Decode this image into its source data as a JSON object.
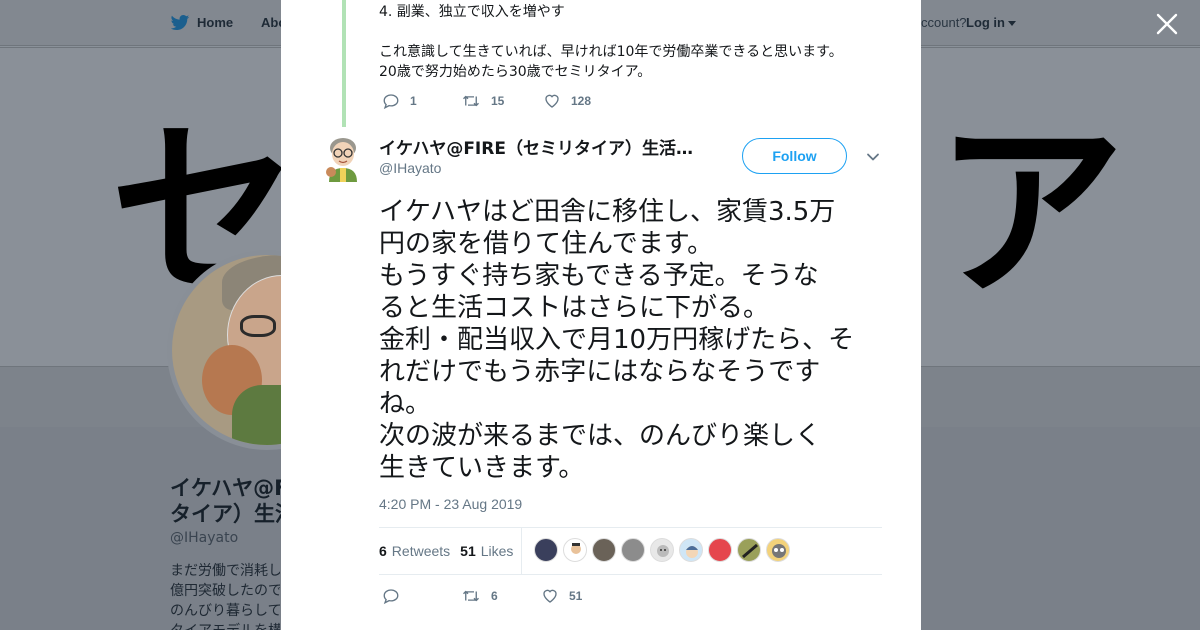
{
  "background": {
    "nav": {
      "home_label": "Home",
      "about_label": "Abo",
      "account_prompt": "ccount?",
      "login_label": "Log in"
    },
    "banner": {
      "left_glyph": "セ",
      "right_glyph": "ア"
    },
    "profile": {
      "name_line1": "イケハヤ@F",
      "name_line2": "タイア）生活",
      "handle": "@IHayato",
      "bio_lines": [
        "まだ労働で消耗し",
        "億円突破したので",
        "のんびり暮らして",
        "タイアモデルを構"
      ]
    }
  },
  "parent_tweet": {
    "lines": [
      "4. 副業、独立で収入を増やす",
      "",
      "これ意識して生きていれば、早ければ10年で労働卒業できると思います。",
      "20歳で努力始めたら30歳でセミリタイア。"
    ],
    "reply_count": "1",
    "retweet_count": "15",
    "like_count": "128"
  },
  "tweet": {
    "display_name": "イケハヤ@FIRE（セミリタイア）生活…",
    "handle": "@IHayato",
    "follow_label": "Follow",
    "text_lines": [
      "イケハヤはど田舎に移住し、家賃3.5万",
      "円の家を借りて住んでます。",
      "もうすぐ持ち家もできる予定。そうな",
      "ると生活コストはさらに下がる。",
      "金利・配当収入で月10万円稼げたら、そ",
      "れだけでもう赤字にはならなそうです",
      "ね。",
      "次の波が来るまでは、のんびり楽しく",
      "生きていきます。"
    ],
    "timestamp": "4:20 PM - 23 Aug 2019",
    "retweets_num": "6",
    "retweets_label": "Retweets",
    "likes_num": "51",
    "likes_label": "Likes",
    "liker_faces": [
      "liker-1",
      "liker-2",
      "liker-3",
      "liker-4",
      "liker-5",
      "liker-6",
      "liker-7",
      "liker-8",
      "liker-9"
    ],
    "reply_count": "",
    "retweet_count": "6",
    "like_count": "51"
  },
  "colors": {
    "twitter_blue": "#1da1f2",
    "thread_line": "#b1e2b5",
    "secondary_text": "#657786"
  },
  "icons": {
    "close": "close-icon",
    "bird": "twitter-bird-icon",
    "reply": "reply-icon",
    "retweet": "retweet-icon",
    "like": "heart-icon",
    "more": "chevron-down-icon"
  }
}
